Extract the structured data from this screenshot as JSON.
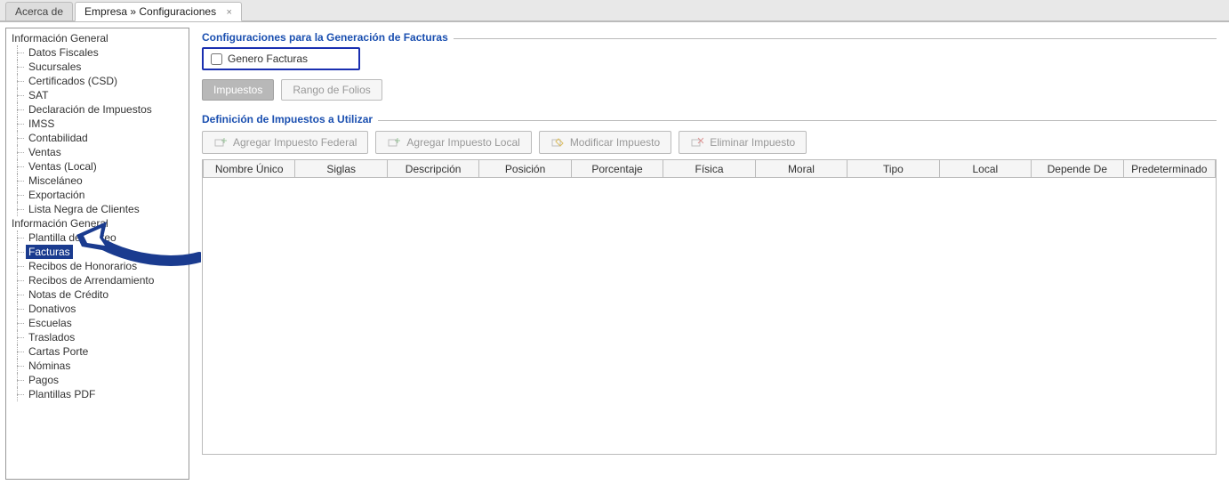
{
  "tabs": {
    "inactive": "Acerca de",
    "active": "Empresa » Configuraciones",
    "close_glyph": "×"
  },
  "tree": {
    "group1": {
      "label": "Información General",
      "items": [
        "Datos Fiscales",
        "Sucursales",
        "Certificados (CSD)",
        "SAT",
        "Declaración de Impuestos",
        "IMSS",
        "Contabilidad",
        "Ventas",
        "Ventas (Local)",
        "Misceláneo",
        "Exportación",
        "Lista Negra de Clientes"
      ]
    },
    "group2": {
      "label": "Información General",
      "items": [
        "Plantilla de Correo",
        "Facturas",
        "Recibos de Honorarios",
        "Recibos de Arrendamiento",
        "Notas de Crédito",
        "Donativos",
        "Escuelas",
        "Traslados",
        "Cartas Porte",
        "Nóminas",
        "Pagos",
        "Plantillas PDF"
      ],
      "selected_index": 1
    }
  },
  "panel1": {
    "legend": "Configuraciones para la Generación de Facturas",
    "checkbox_label": "Genero Facturas",
    "btn_impuestos": "Impuestos",
    "btn_rango": "Rango de Folios"
  },
  "panel2": {
    "legend": "Definición de Impuestos a Utilizar",
    "btn_add_fed": "Agregar Impuesto Federal",
    "btn_add_loc": "Agregar Impuesto Local",
    "btn_mod": "Modificar Impuesto",
    "btn_del": "Eliminar Impuesto",
    "columns": [
      "Nombre Único",
      "Siglas",
      "Descripción",
      "Posición",
      "Porcentaje",
      "Física",
      "Moral",
      "Tipo",
      "Local",
      "Depende De",
      "Predeterminado"
    ]
  }
}
